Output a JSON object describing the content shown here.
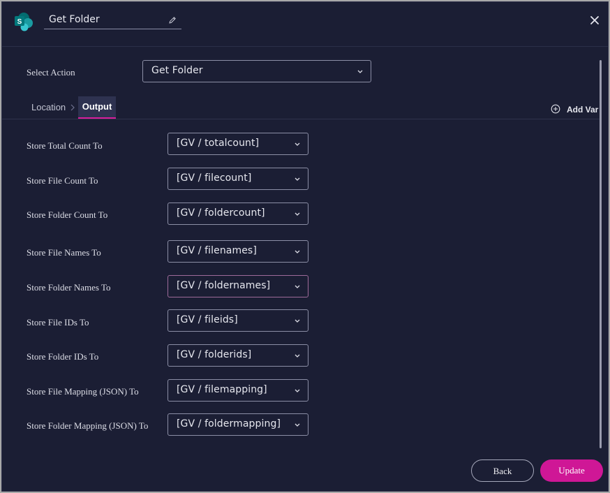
{
  "header": {
    "title": "Get Folder",
    "app_icon": "sharepoint-icon",
    "edit_icon": "pencil-icon",
    "close_icon": "close-icon"
  },
  "select_action": {
    "label": "Select Action",
    "value": "Get Folder"
  },
  "tabs": [
    {
      "label": "Location",
      "active": false
    },
    {
      "label": "Output",
      "active": true
    }
  ],
  "add_var": {
    "label": "Add Var",
    "icon": "plus-circle-icon"
  },
  "fields": [
    {
      "label": "Store Total Count To",
      "value": "[GV / totalcount]"
    },
    {
      "label": "Store File Count To",
      "value": "[GV / filecount]"
    },
    {
      "label": "Store Folder Count To",
      "value": "[GV / foldercount]"
    },
    {
      "label": "Store File Names To",
      "value": "[GV / filenames]"
    },
    {
      "label": "Store Folder Names To",
      "value": "[GV / foldernames]"
    },
    {
      "label": "Store File IDs To",
      "value": "[GV / fileids]"
    },
    {
      "label": "Store Folder IDs To",
      "value": "[GV / folderids]"
    },
    {
      "label": "Store File Mapping (JSON) To",
      "value": "[GV / filemapping]"
    },
    {
      "label": "Store Folder Mapping (JSON) To",
      "value": "[GV / foldermapping]"
    }
  ],
  "buttons": {
    "back": "Back",
    "update": "Update"
  },
  "colors": {
    "background": "#1b1e34",
    "accent": "#cf1796",
    "tab_active_bg": "#2e3250"
  }
}
